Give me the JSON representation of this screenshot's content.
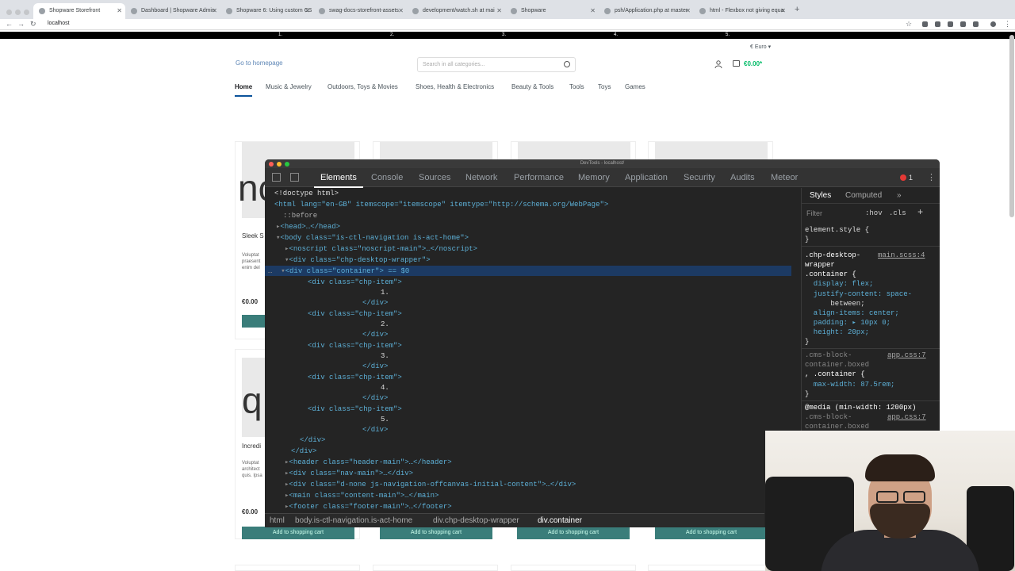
{
  "browser": {
    "tabs": [
      {
        "label": "Shopware Storefront"
      },
      {
        "label": "Dashboard | Shopware Admin"
      },
      {
        "label": "Shopware 6: Using custom CS"
      },
      {
        "label": "swag-docs-storefront-assets"
      },
      {
        "label": "development/watch.sh at mai"
      },
      {
        "label": "Shopware"
      },
      {
        "label": "psh/Application.php at master"
      },
      {
        "label": "html - Flexbox not giving equa"
      }
    ],
    "url": "localhost"
  },
  "chp_items": [
    "1.",
    "2.",
    "3.",
    "4.",
    "5."
  ],
  "store": {
    "currency": "€ Euro",
    "logo_alt": "Go to homepage",
    "search_placeholder": "Search in all categories...",
    "cart_total": "€0.00*",
    "nav": [
      "Home",
      "Music & Jewelry",
      "Outdoors, Toys & Movies",
      "Shoes, Health & Electronics",
      "Beauty & Tools",
      "Tools",
      "Toys",
      "Games"
    ],
    "cards": {
      "row1_title": "Sleek S",
      "row1_desc": "Voluptat praesent enim del",
      "row1_letters": "nc",
      "row2_title": "Incredi",
      "row2_desc": "Voluptat architect quis. Ipsa",
      "row2_letters": "q",
      "price": "€0.00",
      "add_to_cart": "Add to shopping cart"
    }
  },
  "devtools": {
    "title": "DevTools - localhost/",
    "tabs": [
      "Elements",
      "Console",
      "Sources",
      "Network",
      "Performance",
      "Memory",
      "Application",
      "Security",
      "Audits",
      "Meteor"
    ],
    "error_count": "1",
    "dom_lines": [
      "<!doctype html>",
      "<html lang=\"en-GB\" itemscope=\"itemscope\" itemtype=\"http://schema.org/WebPage\">",
      "::before",
      "<head>…</head>",
      "<body class=\"is-ctl-navigation is-act-home\">",
      "<noscript class=\"noscript-main\">…</noscript>",
      "<div class=\"chp-desktop-wrapper\">",
      "<div class=\"container\"> == $0",
      "<div class=\"chp-item\">",
      "1.",
      "</div>",
      "<div class=\"chp-item\">",
      "2.",
      "</div>",
      "<div class=\"chp-item\">",
      "3.",
      "</div>",
      "<div class=\"chp-item\">",
      "4.",
      "</div>",
      "<div class=\"chp-item\">",
      "5.",
      "</div>",
      "</div>",
      "</div>",
      "<header class=\"header-main\">…</header>",
      "<div class=\"nav-main\">…</div>",
      "<div class=\"d-none js-navigation-offcanvas-initial-content\">…</div>",
      "<main class=\"content-main\">…</main>",
      "<footer class=\"footer-main\">…</footer>"
    ],
    "breadcrumbs": [
      "html",
      "body.is-ctl-navigation.is-act-home",
      "div.chp-desktop-wrapper",
      "div.container"
    ],
    "styles": {
      "tabs": [
        "Styles",
        "Computed"
      ],
      "filter_placeholder": "Filter",
      "hov": ":hov",
      "cls": ".cls",
      "lines": [
        "element.style {",
        "}",
        ".chp-desktop-",
        "wrapper",
        ".container {",
        "  display: flex;",
        "  justify-content: space-",
        "      between;",
        "  align-items: center;",
        "  padding: ▸ 10px 0;",
        "  height: 20px;",
        "}",
        ".cms-block-",
        "container.boxed",
        ", .container {",
        "  max-width: 87.5rem;",
        "}",
        "@media (min-width: 1200px)",
        ".cms-block-",
        "container.boxed"
      ],
      "src1": "main.scss:4",
      "src2": "app.css:7",
      "src3": "app.css:7"
    }
  }
}
